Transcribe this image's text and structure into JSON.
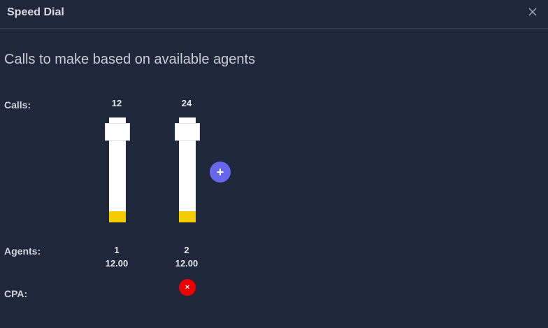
{
  "dialog": {
    "title": "Speed Dial",
    "close_icon": "close-icon"
  },
  "heading": "Calls to make based on available agents",
  "labels": {
    "calls": "Calls:",
    "agents": "Agents:",
    "cpa": "CPA:"
  },
  "columns": [
    {
      "calls": "12",
      "agents": "1",
      "cpa": "12.00",
      "fill_fraction": 0.11
    },
    {
      "calls": "24",
      "agents": "2",
      "cpa": "12.00",
      "fill_fraction": 0.11
    }
  ],
  "add_button": {
    "label": "+",
    "icon": "plus-icon",
    "color": "#6666ea"
  },
  "remove_button": {
    "label": "×",
    "icon": "close-icon",
    "color": "#ee0000"
  },
  "colors": {
    "background": "#1f283a",
    "slider_fill": "#f5cc00",
    "track": "#ffffff"
  }
}
